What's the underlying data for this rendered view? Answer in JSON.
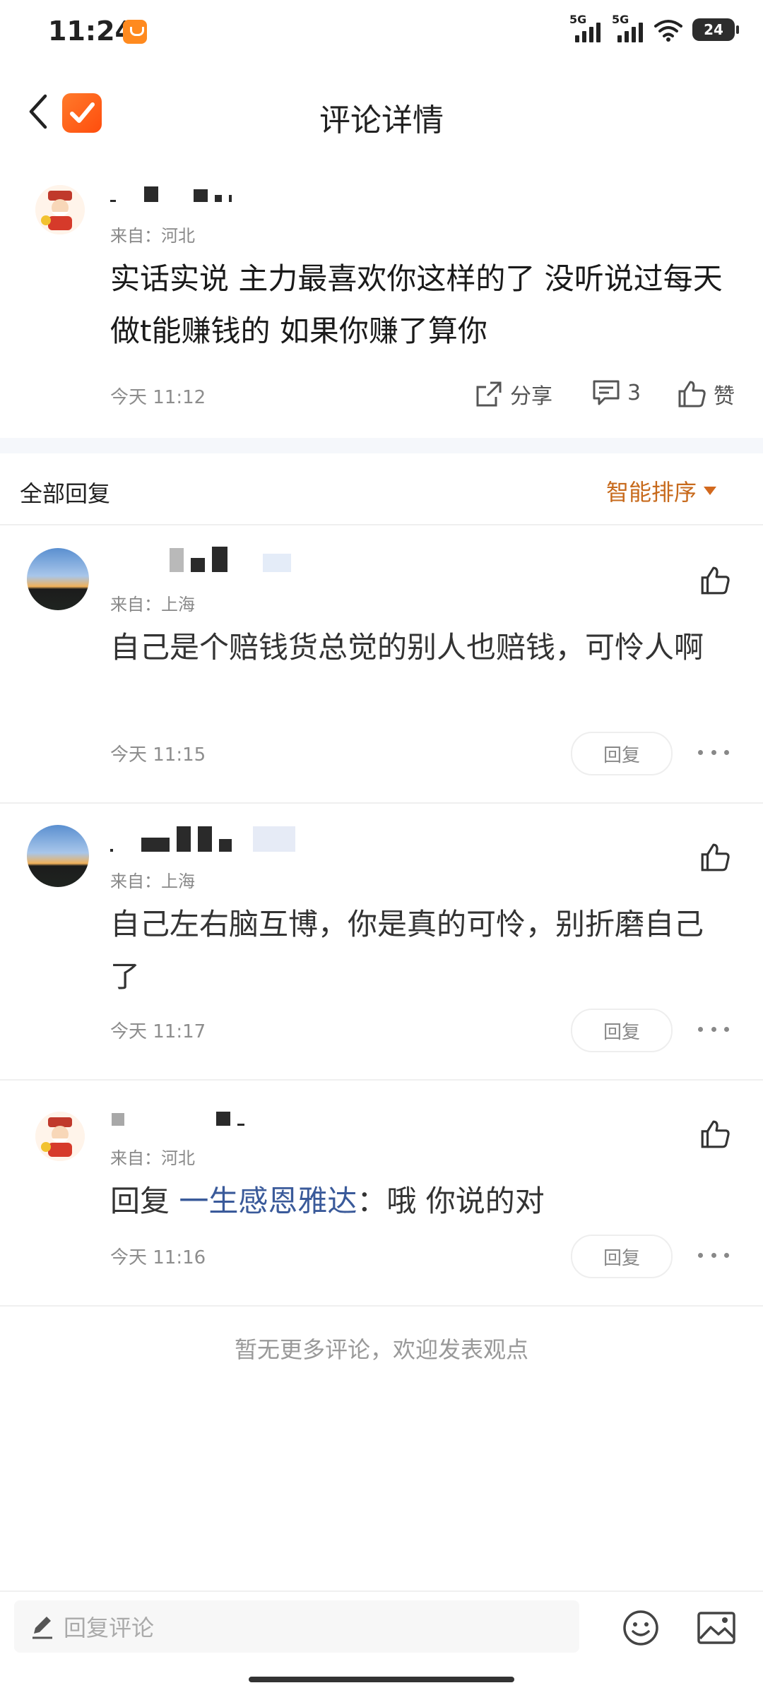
{
  "status_bar": {
    "time": "11:24",
    "sim1": "5G",
    "sim2": "5G",
    "battery": "24"
  },
  "header": {
    "title": "评论详情"
  },
  "main_comment": {
    "from": "来自：河北",
    "text": "实话实说 主力最喜欢你这样的了 没听说过每天做t能赚钱的 如果你赚了算你",
    "time": "今天 11:12",
    "share_label": "分享",
    "comment_count": "3",
    "like_label": "赞"
  },
  "replies_section": {
    "label": "全部回复",
    "sort_label": "智能排序"
  },
  "replies": [
    {
      "from": "来自：上海",
      "text": "自己是个赔钱货总觉的别人也赔钱，可怜人啊",
      "time": "今天 11:15",
      "reply_label": "回复"
    },
    {
      "from": "来自：上海",
      "text": "自己左右脑互博，你是真的可怜，别折磨自己了",
      "time": "今天 11:17",
      "reply_label": "回复"
    },
    {
      "from": "来自：河北",
      "reply_prefix": "回复",
      "reply_target": "一生感恩雅达",
      "text": "：哦 你说的对",
      "time": "今天 11:16",
      "reply_label": "回复"
    }
  ],
  "end_note": "暂无更多评论，欢迎发表观点",
  "composer": {
    "placeholder": "回复评论"
  },
  "colors": {
    "accent": "#d2691e",
    "link": "#3a5a9a"
  }
}
